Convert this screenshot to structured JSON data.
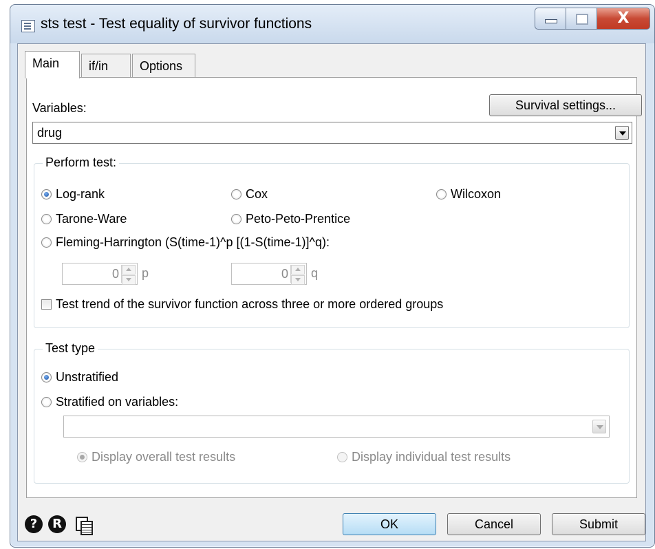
{
  "window": {
    "title": "sts test - Test equality of survivor functions",
    "close_glyph": "X"
  },
  "tabs": [
    {
      "label": "Main",
      "active": true
    },
    {
      "label": "if/in",
      "active": false
    },
    {
      "label": "Options",
      "active": false
    }
  ],
  "main": {
    "variables_label": "Variables:",
    "variables_value": "drug",
    "survival_settings_label": "Survival settings...",
    "perform_test": {
      "title": "Perform test:",
      "options": {
        "logrank": "Log-rank",
        "cox": "Cox",
        "wilcoxon": "Wilcoxon",
        "tarone": "Tarone-Ware",
        "peto": "Peto-Peto-Prentice",
        "fleming": "Fleming-Harrington (S(time-1)^p [(1-S(time-1)]^q):"
      },
      "selected": "Log-rank",
      "p_value": "0",
      "p_label": "p",
      "q_value": "0",
      "q_label": "q",
      "trend_label": "Test trend of the survivor function across three or more ordered groups",
      "trend_checked": false
    },
    "test_type": {
      "title": "Test type",
      "unstratified": "Unstratified",
      "stratified": "Stratified on variables:",
      "selected": "Unstratified",
      "strata_value": "",
      "display_overall": "Display overall test results",
      "display_individual": "Display individual test results"
    }
  },
  "footer": {
    "help_glyph": "?",
    "reset_glyph": "R",
    "ok_label": "OK",
    "cancel_label": "Cancel",
    "submit_label": "Submit"
  },
  "colors": {
    "title_bar": "#c9d9ec",
    "dialog_bg": "#f0f0f0",
    "close_button": "#c84a35",
    "ok_button": "#cbe8f9",
    "radio_selected": "#1a4fa0"
  }
}
